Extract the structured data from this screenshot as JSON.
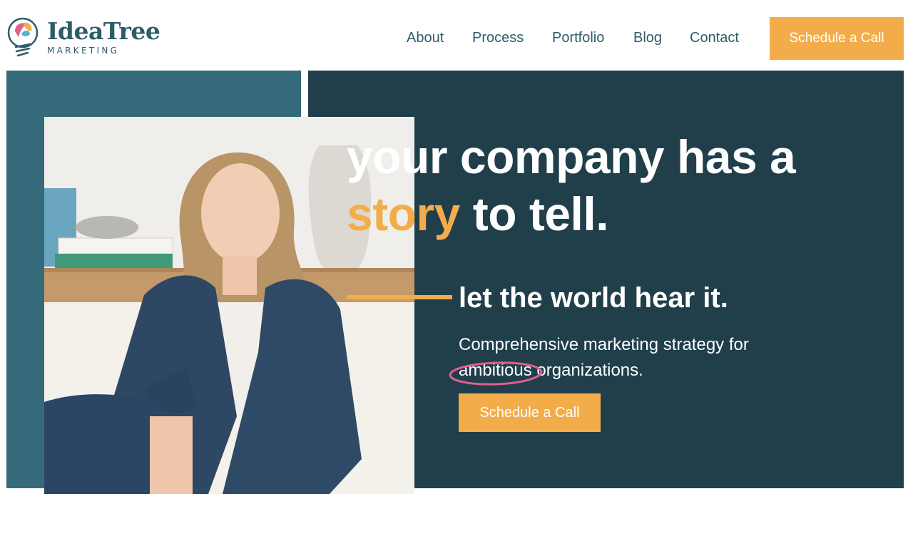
{
  "brand": {
    "name": "IdeaTree",
    "tagline": "MARKETING"
  },
  "nav": {
    "items": [
      {
        "label": "About"
      },
      {
        "label": "Process"
      },
      {
        "label": "Portfolio"
      },
      {
        "label": "Blog"
      },
      {
        "label": "Contact"
      }
    ],
    "cta_label": "Schedule a Call"
  },
  "hero": {
    "headline_line1": "your company has a",
    "headline_accent": "story",
    "headline_line2_rest": "to tell.",
    "subheadline": "let the world hear it.",
    "description_line1": "Comprehensive marketing strategy for",
    "description_circled_word": "ambitious",
    "description_rest": " organizations.",
    "cta_label": "Schedule a Call"
  },
  "colors": {
    "accent": "#f2ad4a",
    "dark_teal": "#203f4b",
    "teal": "#356a7a",
    "brand_text": "#2d5c68",
    "circle_mark": "#e0608e"
  }
}
